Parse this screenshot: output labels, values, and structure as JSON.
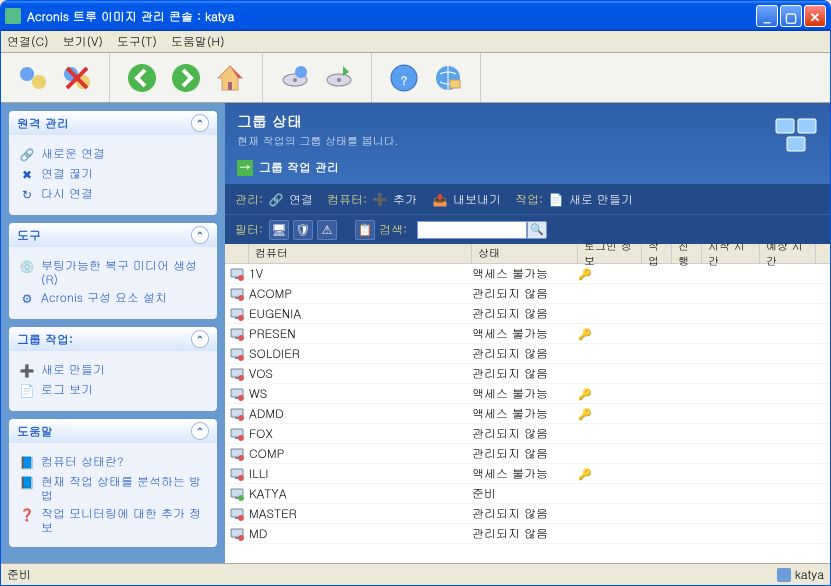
{
  "title": "Acronis 트루 이미지 관리 콘솔 : katya",
  "menu": {
    "connect": "연결(C)",
    "view": "보기(V)",
    "tool": "도구(T)",
    "help": "도움말(H)"
  },
  "sidebar": {
    "remote": {
      "title": "원격 관리",
      "items": [
        "새로운 연결",
        "연결 끊기",
        "다시 연결"
      ]
    },
    "tools": {
      "title": "도구",
      "items": [
        "부팅가능한 복구 미디어 생성(R)",
        "Acronis 구성 요소 설치"
      ]
    },
    "group": {
      "title": "그룹 작업:",
      "items": [
        "새로 만들기",
        "로그 보기"
      ]
    },
    "helpp": {
      "title": "도움말",
      "items": [
        "컴퓨터 상태란?",
        "현재 작업 상태를 분석하는 방법",
        "작업 모니터링에 대한 추가 정보"
      ]
    }
  },
  "header": {
    "title": "그룹 상태",
    "sub": "현재 작업의 그룹 상태를 봅니다.",
    "task": "그룹 작업 관리"
  },
  "actionbar": {
    "manage": "관리:",
    "connect": "연결",
    "computer": "컴퓨터:",
    "add": "추가",
    "export": "내보내기",
    "job": "작업:",
    "new": "새로 만들기"
  },
  "filterbar": {
    "filter": "필터:",
    "search": "검색:",
    "value": ""
  },
  "columns": {
    "computer": "컴퓨터",
    "status": "상태",
    "login": "로그인 정보",
    "job": "작업",
    "prog": "진행",
    "start": "시작 시간",
    "est": "예상 시간"
  },
  "rows": [
    {
      "icon": "red",
      "name": "1V",
      "status": "액세스 불가능",
      "login": true
    },
    {
      "icon": "red",
      "name": "ACOMP",
      "status": "관리되지 않음"
    },
    {
      "icon": "red",
      "name": "EUGENIA",
      "status": "관리되지 않음"
    },
    {
      "icon": "red",
      "name": "PRESEN",
      "status": "액세스 불가능",
      "login": true
    },
    {
      "icon": "red",
      "name": "SOLDIER",
      "status": "관리되지 않음"
    },
    {
      "icon": "red",
      "name": "VOS",
      "status": "관리되지 않음"
    },
    {
      "icon": "red",
      "name": "WS",
      "status": "액세스 불가능",
      "login": true
    },
    {
      "icon": "red",
      "name": "ADMD",
      "status": "액세스 불가능",
      "login": true
    },
    {
      "icon": "red",
      "name": "FOX",
      "status": "관리되지 않음"
    },
    {
      "icon": "red",
      "name": "COMP",
      "status": "관리되지 않음"
    },
    {
      "icon": "red",
      "name": "ILLI",
      "status": "액세스 불가능",
      "login": true
    },
    {
      "icon": "green",
      "name": "KATYA",
      "status": "준비"
    },
    {
      "icon": "red",
      "name": "MASTER",
      "status": "관리되지 않음"
    },
    {
      "icon": "red",
      "name": "MD",
      "status": "관리되지 않음"
    }
  ],
  "status": {
    "ready": "준비",
    "user": "katya"
  }
}
